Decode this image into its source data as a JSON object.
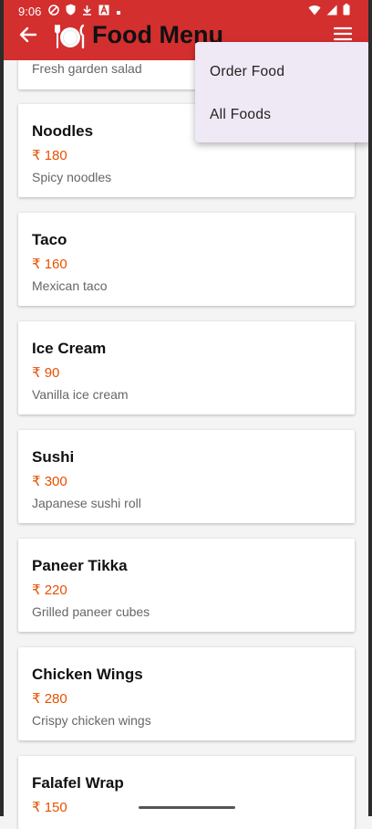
{
  "status_bar": {
    "time": "9:06"
  },
  "app_bar": {
    "title": "Food Menu"
  },
  "menu": {
    "items": [
      "Order Food",
      "All Foods"
    ]
  },
  "foods": [
    {
      "name": "",
      "price": "",
      "description": "Fresh garden salad"
    },
    {
      "name": "Noodles",
      "price": "₹ 180",
      "description": "Spicy noodles"
    },
    {
      "name": "Taco",
      "price": "₹ 160",
      "description": "Mexican taco"
    },
    {
      "name": "Ice Cream",
      "price": "₹ 90",
      "description": "Vanilla ice cream"
    },
    {
      "name": "Sushi",
      "price": "₹ 300",
      "description": "Japanese sushi roll"
    },
    {
      "name": "Paneer Tikka",
      "price": "₹ 220",
      "description": "Grilled paneer cubes"
    },
    {
      "name": "Chicken Wings",
      "price": "₹ 280",
      "description": "Crispy chicken wings"
    },
    {
      "name": "Falafel Wrap",
      "price": "₹ 150",
      "description": ""
    }
  ],
  "colors": {
    "app_bar": "#d32f2f",
    "price": "#e65100",
    "menu_bg": "#efe8f5"
  }
}
